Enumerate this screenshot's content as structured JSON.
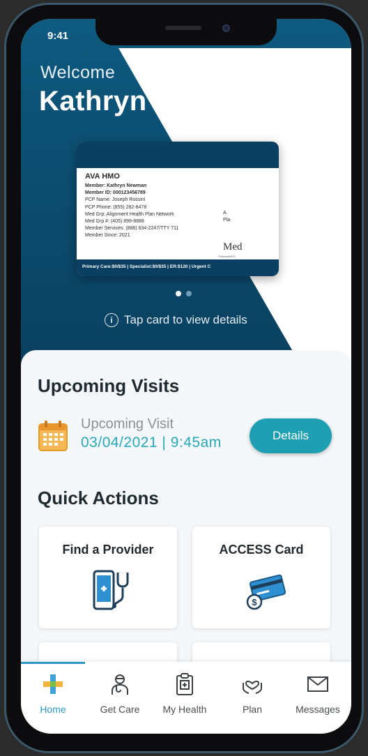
{
  "status": {
    "time": "9:41"
  },
  "hero": {
    "welcome": "Welcome",
    "name": "Kathryn",
    "tap_hint": "Tap card to view details"
  },
  "member_card": {
    "plan": "AVA HMO",
    "lines": [
      "Member: Kathryn Newman",
      "Member ID: 000123456789",
      "PCP Name: Joseph Rossini",
      "PCP Phone: (855) 282-8478",
      "Med Grp: Alignment Health Plan Network",
      "Med Grp #: (405) 899-8888",
      "Member Services: (866) 634-2247/TTY 711",
      "Member Since: 2021"
    ],
    "right_lines": [
      "A",
      "Pla"
    ],
    "logo": "Med",
    "logo_sub": "Prescription D",
    "footer": "Primary Care:$0/$35 | Specialist:$0/$35 | ER:$120 | Urgent C"
  },
  "pager": {
    "pages": 2,
    "active": 0
  },
  "upcoming": {
    "title": "Upcoming Visits",
    "label": "Upcoming Visit",
    "date": "03/04/2021 | 9:45am",
    "details_button": "Details"
  },
  "quick_actions": {
    "title": "Quick Actions",
    "cards": [
      {
        "label": "Find a Provider",
        "icon": "phone-stethoscope-icon"
      },
      {
        "label": "ACCESS Card",
        "icon": "card-payment-icon"
      }
    ]
  },
  "tabs": [
    {
      "label": "Home",
      "icon": "home-cross-icon",
      "active": true
    },
    {
      "label": "Get Care",
      "icon": "doctor-icon",
      "active": false
    },
    {
      "label": "My Health",
      "icon": "clipboard-heart-icon",
      "active": false
    },
    {
      "label": "Plan",
      "icon": "hands-heart-icon",
      "active": false
    },
    {
      "label": "Messages",
      "icon": "envelope-icon",
      "active": false
    }
  ],
  "colors": {
    "hero": "#0b4a6c",
    "accent": "#1f9fb2",
    "tab_active": "#2e97c4",
    "card_strip": "#0b3f61"
  }
}
